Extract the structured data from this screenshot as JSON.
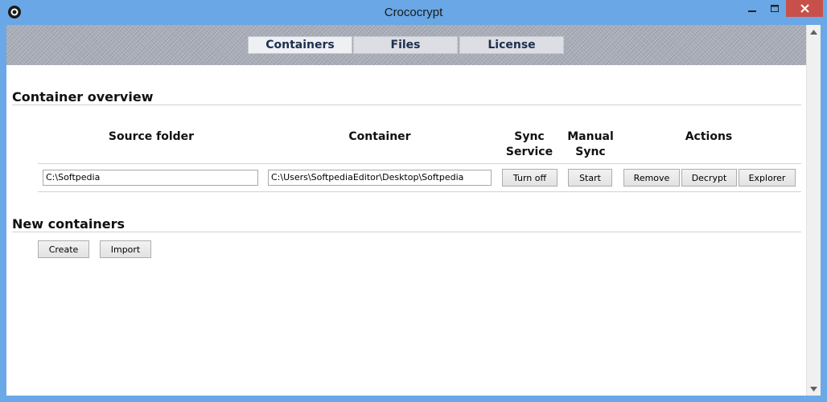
{
  "window": {
    "title": "Crococrypt"
  },
  "tabs": [
    {
      "label": "Containers",
      "active": true
    },
    {
      "label": "Files",
      "active": false
    },
    {
      "label": "License",
      "active": false
    }
  ],
  "overview": {
    "title": "Container overview",
    "headers": {
      "source": "Source folder",
      "container": "Container",
      "sync_line1": "Sync",
      "sync_line2": "Service",
      "manual_line1": "Manual",
      "manual_line2": "Sync",
      "actions": "Actions"
    },
    "row": {
      "source": "C:\\Softpedia",
      "container": "C:\\Users\\SoftpediaEditor\\Desktop\\Softpedia",
      "sync_button": "Turn off",
      "manual_button": "Start",
      "remove_button": "Remove",
      "decrypt_button": "Decrypt",
      "explorer_button": "Explorer"
    }
  },
  "new_containers": {
    "title": "New containers",
    "create_button": "Create",
    "import_button": "Import"
  },
  "colors": {
    "titlebar": "#69a7e6",
    "close": "#c7514a",
    "tab_text": "#1c2f4f"
  },
  "icons": {
    "app": "crococrypt-logo-icon",
    "minimize": "minimize-icon",
    "maximize": "maximize-icon",
    "close": "close-icon",
    "scroll_up": "arrow-up-icon",
    "scroll_down": "arrow-down-icon"
  }
}
